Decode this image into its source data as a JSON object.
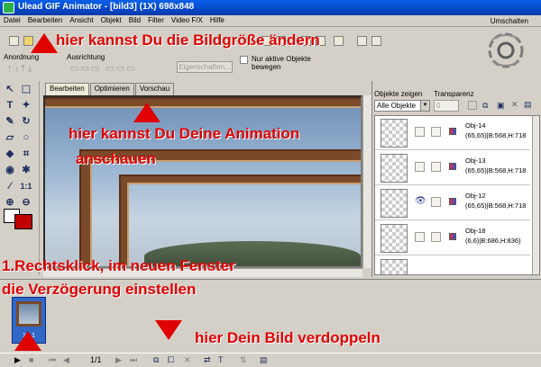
{
  "window": {
    "title": "Ulead GIF Animator - [bild3] (1X) 698x848"
  },
  "menu": {
    "items": [
      "Datei",
      "Bearbeiten",
      "Ansicht",
      "Objekt",
      "Bild",
      "Filter",
      "Video F/X",
      "Hilfe"
    ],
    "right": "Umschalten"
  },
  "toolbar": {
    "anordnung": "Anordnung",
    "ausrichtung": "Ausrichtung",
    "eigenschaften": "Eigenschaften...",
    "only_active": "Nur aktive Objekte bewegen"
  },
  "tabs": [
    "Bearbeiten",
    "Optimieren",
    "Vorschau"
  ],
  "objects_panel": {
    "show_label": "Objekte zeigen",
    "transparency_label": "Transparenz",
    "filter_value": "Alle Objekte",
    "transparency_value": "0",
    "objects": [
      {
        "name": "Obj-14",
        "dims": "(65,65)|B:568,H:718"
      },
      {
        "name": "Obj-13",
        "dims": "(65,65)|B:568,H:718"
      },
      {
        "name": "Obj-12",
        "dims": "(65,65)|B:568,H:718"
      },
      {
        "name": "Obj-18",
        "dims": "(6,6)|B:686,H:836)"
      }
    ]
  },
  "frames": {
    "frame_label": "1 - 1",
    "counter": "1/1"
  },
  "annotations": {
    "size": "hier kannst Du die Bildgröße ändern",
    "preview1": "hier kannst Du Deine Animation",
    "preview2": "anschauen",
    "delay1": "1.Rechtsklick, im neuen Fenster",
    "delay2": "die  Verzögerung einstellen",
    "duplicate": "hier Dein Bild verdoppeln"
  },
  "colors": {
    "annotation": "#e00000",
    "titlebar": "#0a5fe8",
    "selected_frame": "#3168c6",
    "bg_color": "#c00000"
  }
}
